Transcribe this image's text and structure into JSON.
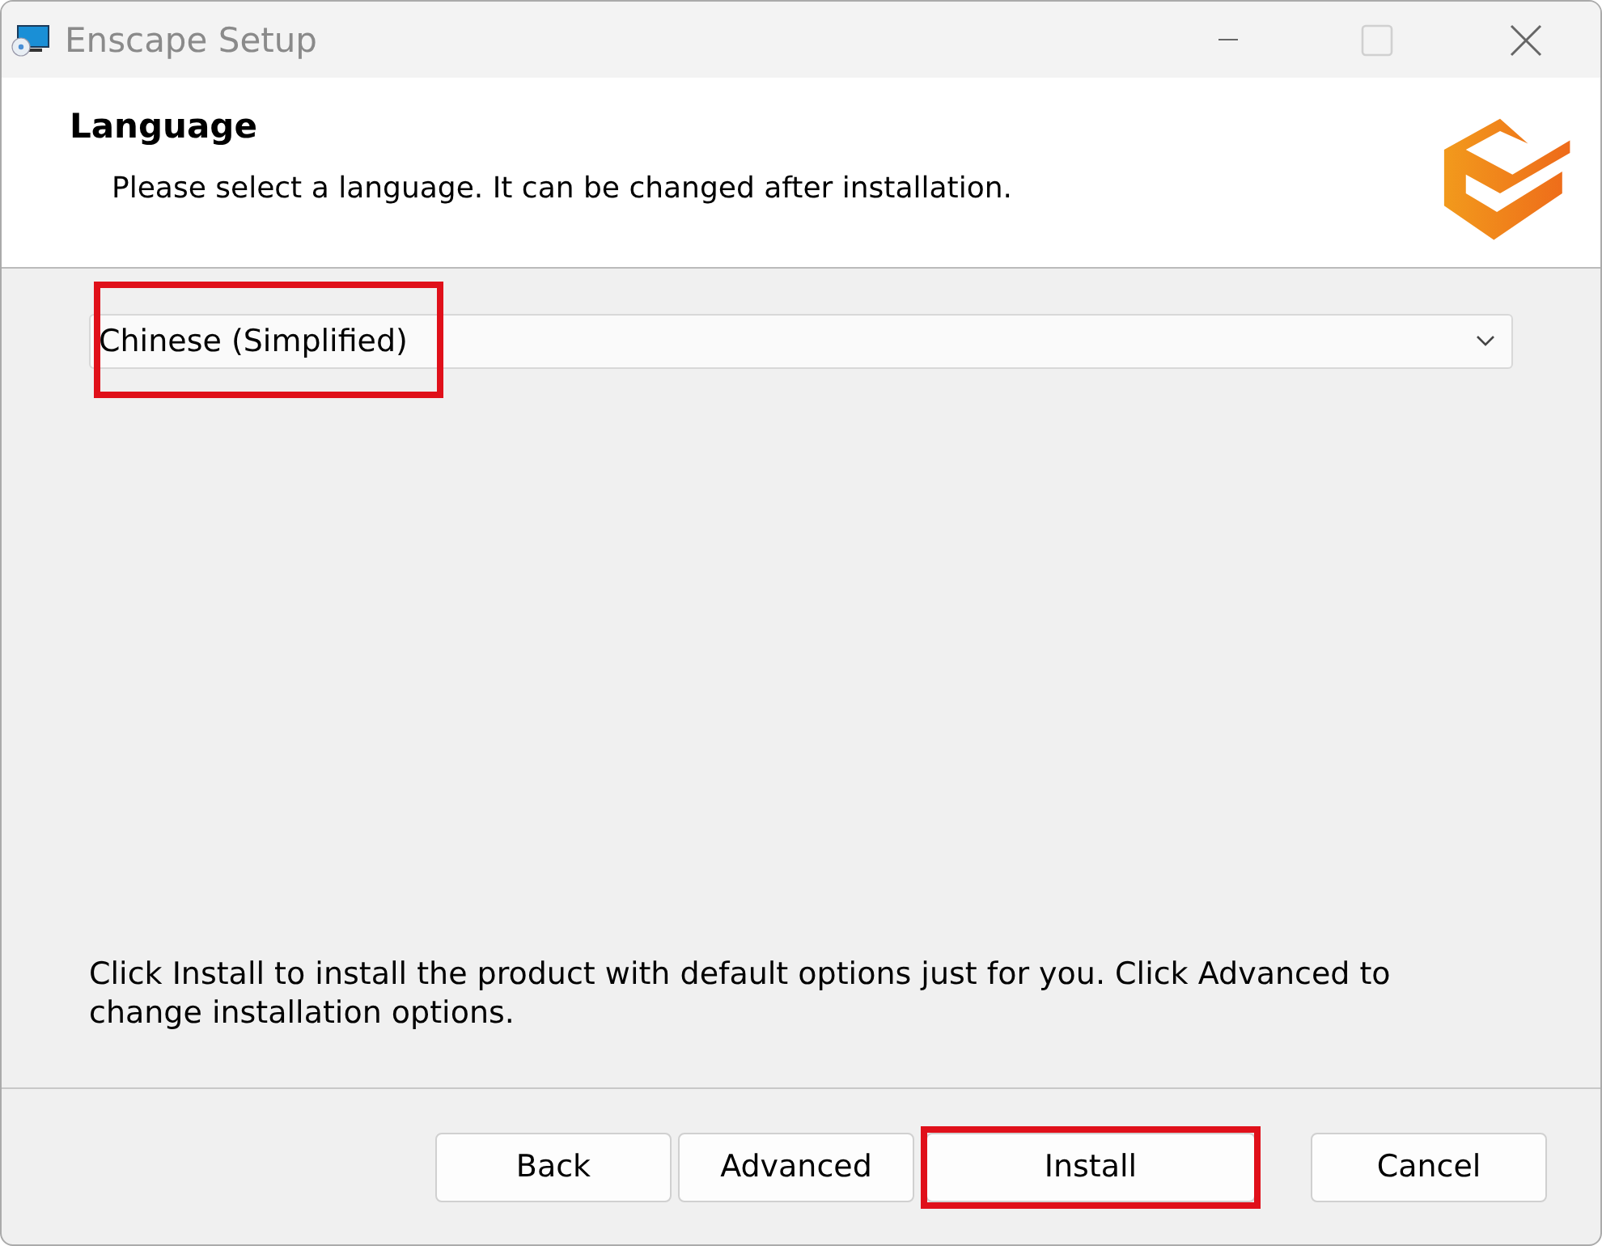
{
  "window": {
    "title": "Enscape Setup",
    "active": false,
    "maximize_disabled": true
  },
  "header": {
    "title": "Language",
    "subtitle": "Please select a language. It can be changed after installation."
  },
  "language_dropdown": {
    "value": "Chinese (Simplified)",
    "highlighted": true
  },
  "description": "Click Install to install the product with default options just for you. Click Advanced to change installation options.",
  "buttons": [
    {
      "label": "Back",
      "highlighted": false
    },
    {
      "label": "Advanced",
      "highlighted": false
    },
    {
      "label": "Install",
      "highlighted": true
    },
    {
      "label": "Cancel",
      "highlighted": false
    }
  ]
}
